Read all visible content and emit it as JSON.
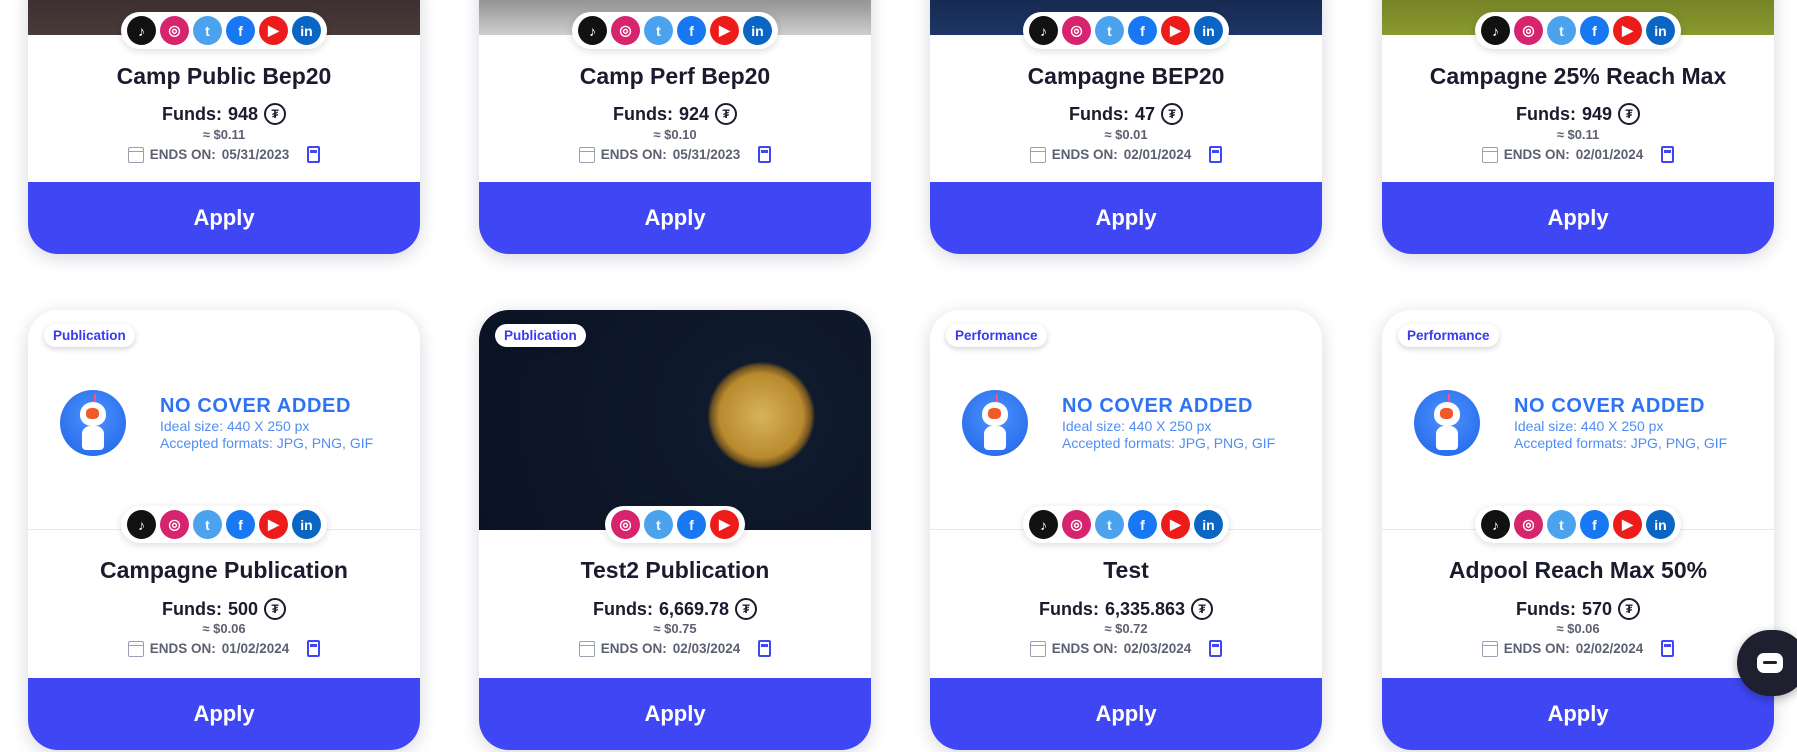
{
  "colors": {
    "accent": "#3f47f4",
    "no_cover_text": "#2f73f5",
    "title": "#1b1b2f"
  },
  "common": {
    "apply_label": "Apply",
    "ends_prefix": "ENDS ON: ",
    "funds_prefix": "Funds: ",
    "coin_symbol": "₮"
  },
  "cards": [
    {
      "title": "Camp Public Bep20",
      "funds": "948",
      "usd": "≈ $0.11",
      "ends": "05/31/2023",
      "socials": [
        "tiktok",
        "instagram",
        "twitter",
        "facebook",
        "youtube",
        "linkedin"
      ],
      "cover": "image-dark"
    },
    {
      "title": "Camp Perf Bep20",
      "funds": "924",
      "usd": "≈ $0.10",
      "ends": "05/31/2023",
      "socials": [
        "tiktok",
        "instagram",
        "twitter",
        "facebook",
        "youtube",
        "linkedin"
      ],
      "cover": "image-road"
    },
    {
      "title": "Campagne BEP20",
      "funds": "47",
      "usd": "≈ $0.01",
      "ends": "02/01/2024",
      "socials": [
        "tiktok",
        "instagram",
        "twitter",
        "facebook",
        "youtube",
        "linkedin"
      ],
      "cover": "image-blue"
    },
    {
      "title": "Campagne 25% Reach Max",
      "funds": "949",
      "usd": "≈ $0.11",
      "ends": "02/01/2024",
      "socials": [
        "tiktok",
        "instagram",
        "twitter",
        "facebook",
        "youtube",
        "linkedin"
      ],
      "cover": "image-field"
    },
    {
      "badge": "Publication",
      "title": "Campagne Publication",
      "funds": "500",
      "usd": "≈ $0.06",
      "ends": "01/02/2024",
      "socials": [
        "tiktok",
        "instagram",
        "twitter",
        "facebook",
        "youtube",
        "linkedin"
      ],
      "cover": "none"
    },
    {
      "badge": "Publication",
      "title": "Test2 Publication",
      "funds": "6,669.78",
      "usd": "≈ $0.75",
      "ends": "02/03/2024",
      "socials": [
        "instagram",
        "twitter",
        "facebook",
        "youtube"
      ],
      "cover": "image-coin"
    },
    {
      "badge": "Performance",
      "title": "Test",
      "funds": "6,335.863",
      "usd": "≈ $0.72",
      "ends": "02/03/2024",
      "socials": [
        "tiktok",
        "instagram",
        "twitter",
        "facebook",
        "youtube",
        "linkedin"
      ],
      "cover": "none"
    },
    {
      "badge": "Performance",
      "title": "Adpool Reach Max 50%",
      "funds": "570",
      "usd": "≈ $0.06",
      "ends": "02/02/2024",
      "socials": [
        "tiktok",
        "instagram",
        "twitter",
        "facebook",
        "youtube",
        "linkedin"
      ],
      "cover": "none"
    }
  ],
  "no_cover": {
    "title": "NO COVER ADDED",
    "line1": "Ideal size: 440 X 250 px",
    "line2": "Accepted formats: JPG, PNG, GIF"
  },
  "chat": {
    "icon": "chat-bubble-icon"
  }
}
